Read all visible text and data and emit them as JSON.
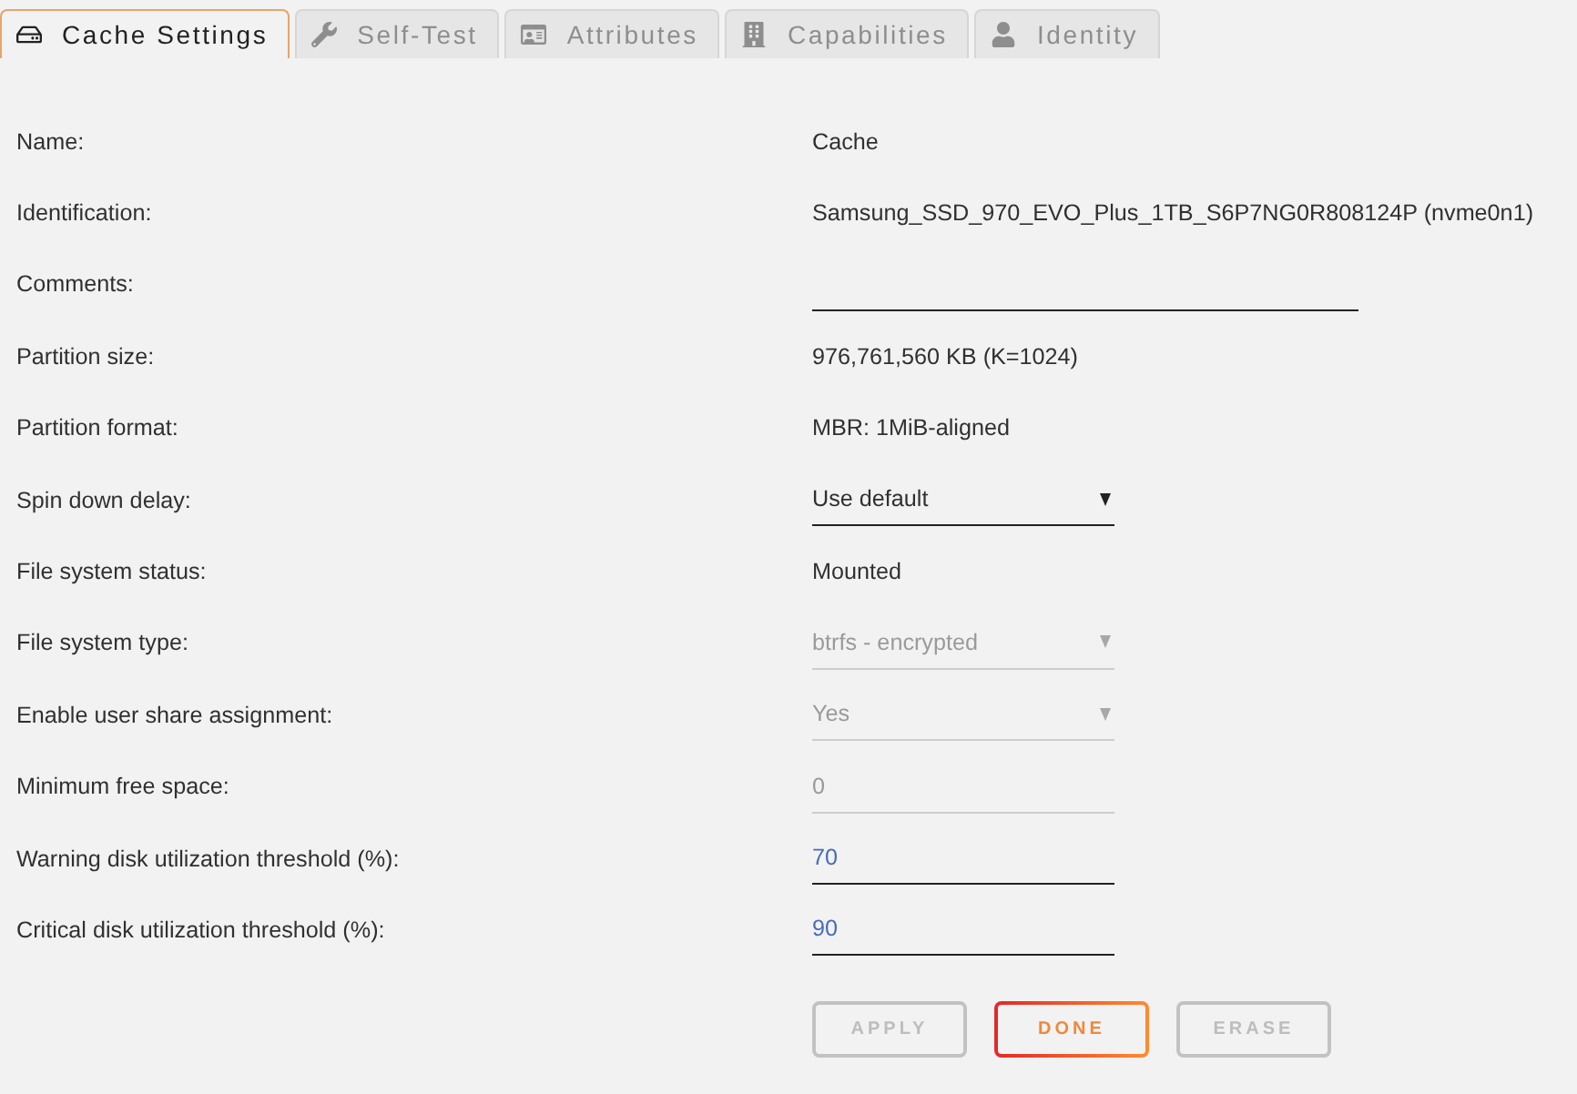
{
  "tabs": [
    {
      "label": "Cache Settings",
      "selected": true
    },
    {
      "label": "Self-Test",
      "selected": false
    },
    {
      "label": "Attributes",
      "selected": false
    },
    {
      "label": "Capabilities",
      "selected": false
    },
    {
      "label": "Identity",
      "selected": false
    }
  ],
  "rows": [
    {
      "label": "Name:",
      "kind": "text",
      "value": "Cache"
    },
    {
      "label": "Identification:",
      "kind": "text",
      "value": "Samsung_SSD_970_EVO_Plus_1TB_S6P7NG0R808124P (nvme0n1)"
    },
    {
      "label": "Comments:",
      "kind": "text-input",
      "disabled": false
    },
    {
      "label": "Partition size:",
      "kind": "text",
      "value": "976,761,560 KB (K=1024)"
    },
    {
      "label": "Partition format:",
      "kind": "text",
      "value": "MBR: 1MiB-aligned"
    },
    {
      "label": "Spin down delay:",
      "kind": "select",
      "value": "Use default",
      "disabled": false
    },
    {
      "label": "File system status:",
      "kind": "text",
      "value": "Mounted"
    },
    {
      "label": "File system type:",
      "kind": "select",
      "value": "btrfs - encrypted",
      "disabled": true
    },
    {
      "label": "Enable user share assignment:",
      "kind": "select",
      "value": "Yes",
      "disabled": true
    },
    {
      "label": "Minimum free space:",
      "kind": "number-input",
      "value": "0",
      "disabled": true
    },
    {
      "label": "Warning disk utilization threshold (%):",
      "kind": "number-input",
      "value": "70",
      "disabled": false
    },
    {
      "label": "Critical disk utilization threshold (%):",
      "kind": "number-input",
      "value": "90",
      "disabled": false
    }
  ],
  "buttons": [
    {
      "label": "APPLY",
      "disabled": true
    },
    {
      "label": "DONE",
      "disabled": false
    },
    {
      "label": "ERASE",
      "disabled": true
    }
  ]
}
